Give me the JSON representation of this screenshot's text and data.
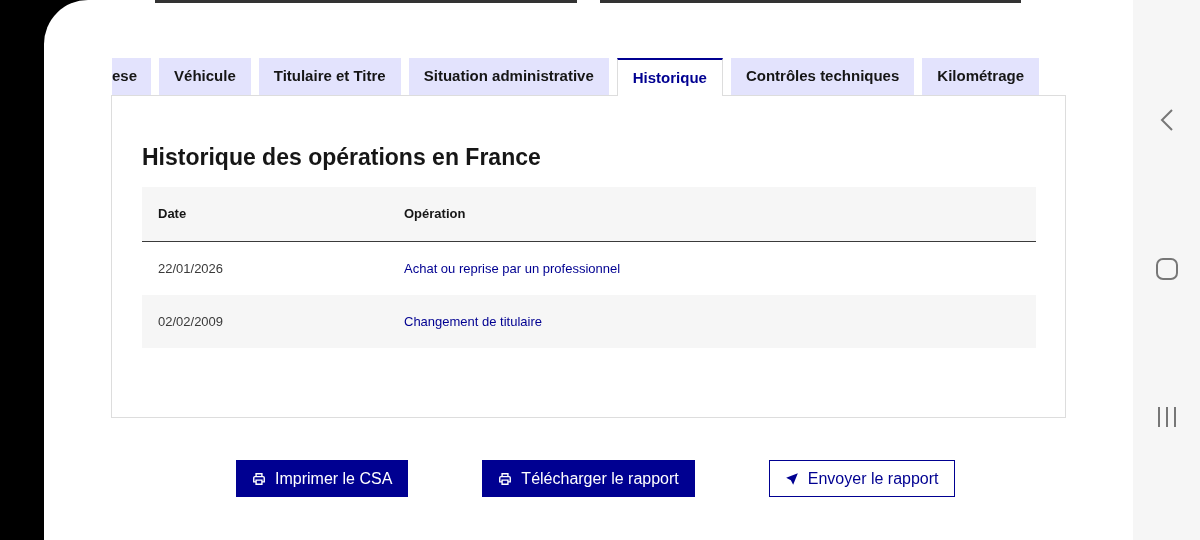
{
  "tabs": [
    {
      "label": "ese",
      "selected": false
    },
    {
      "label": "Véhicule",
      "selected": false
    },
    {
      "label": "Titulaire et Titre",
      "selected": false
    },
    {
      "label": "Situation administrative",
      "selected": false
    },
    {
      "label": "Historique",
      "selected": true
    },
    {
      "label": "Contrôles techniques",
      "selected": false
    },
    {
      "label": "Kilométrage",
      "selected": false
    }
  ],
  "panel": {
    "title": "Historique des opérations en France",
    "table": {
      "columns": [
        "Date",
        "Opération"
      ],
      "rows": [
        {
          "date": "22/01/2026",
          "operation": "Achat ou reprise par un professionnel"
        },
        {
          "date": "02/02/2009",
          "operation": "Changement de titulaire"
        }
      ]
    }
  },
  "buttons": [
    {
      "label": "Imprimer le CSA",
      "kind": "primary"
    },
    {
      "label": "Télécharger le rapport",
      "kind": "primary"
    },
    {
      "label": "Envoyer le rapport",
      "kind": "secondary"
    }
  ]
}
